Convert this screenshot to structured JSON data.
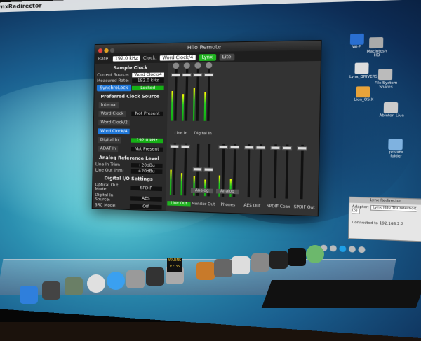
{
  "menubar": {
    "app_name": "LynxRedirector"
  },
  "hilo": {
    "title": "Hilo Remote",
    "toolbar": {
      "rate_label": "Rate:",
      "rate_value": "192.0 kHz",
      "clock_label": "Clock:",
      "clock_value": "Word Clock/4",
      "button1": "Lynx",
      "button2": "Lite"
    },
    "sample_clock": {
      "heading": "Sample Clock",
      "current_source_label": "Current Source:",
      "current_source_value": "Word Clock/4",
      "measured_rate_label": "Measured Rate:",
      "measured_rate_value": "192.0 kHz",
      "synchrolock_label": "SynchroLock",
      "synchrolock_value": "Locked"
    },
    "preferred_clock": {
      "heading": "Preferred Clock Source",
      "sources": [
        {
          "name": "Internal",
          "status": ""
        },
        {
          "name": "Word Clock",
          "status": "Not Present"
        },
        {
          "name": "Word Clock/2",
          "status": ""
        },
        {
          "name": "Word Clock/4",
          "status": ""
        },
        {
          "name": "Digital In",
          "status": "192.0 kHz"
        },
        {
          "name": "ADAT In",
          "status": "Not Present"
        }
      ]
    },
    "analog_ref": {
      "heading": "Analog Reference Level",
      "line_in_label": "Line In Trim:",
      "line_in_value": "+20dBu",
      "line_out_label": "Line Out Trim:",
      "line_out_value": "+20dBu"
    },
    "digital_io": {
      "heading": "Digital I/O Settings",
      "optical_out_label": "Optical Out Mode:",
      "optical_out_value": "SPDIF",
      "digital_in_label": "Digital In Source:",
      "digital_in_value": "AES",
      "src_label": "SRC Mode:",
      "src_value": "Off"
    },
    "mixer": {
      "line_in": "Line In",
      "digital_in": "Digital In",
      "groups": [
        "Line Out",
        "Monitor Out",
        "Phones",
        "AES Out",
        "SPDIF Coax",
        "SPDIF Out"
      ],
      "analog_btn": "Analog",
      "analog_btn2": "Analog",
      "readout": "0.0"
    }
  },
  "lynx_redirector": {
    "title": "Lynx Redirector",
    "adapter_label": "Adapter:",
    "adapter_value": "Lynx Hilo Thunderbolt (5)",
    "status": "Connected to 192.168.2.2"
  },
  "desktop_icons": [
    "Wi-Fi",
    "Macintosh HD",
    "Lynx_DRIVERS",
    "File System Shares",
    "Lion_OS X",
    "Ableton Live",
    "private folder"
  ],
  "dock": {
    "clock_top": "WARNS",
    "clock_time": "V7:35"
  },
  "colors": {
    "accent_green": "#1fb31f",
    "accent_blue": "#1f77d8",
    "window_bg": "#2a2a2a"
  }
}
